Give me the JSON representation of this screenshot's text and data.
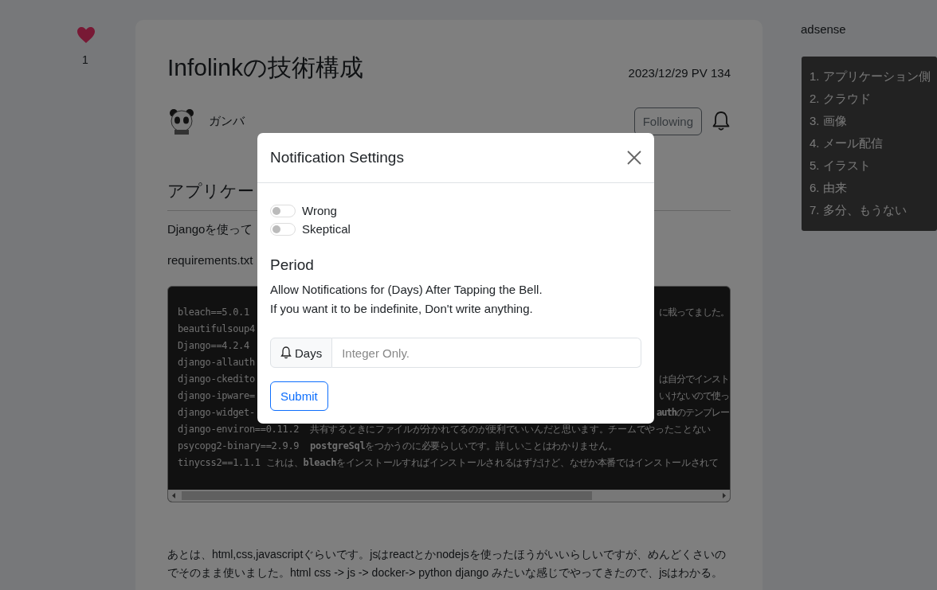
{
  "like": {
    "count": "1"
  },
  "article": {
    "title": "Infolinkの技術構成",
    "meta": "2023/12/29 PV 134",
    "author": "ガンバ",
    "follow_button": "Following",
    "section_heading": "アプリケー",
    "paragraph_1": "Djangoを使って",
    "paragraph_2": "requirements.txt",
    "code_lines": [
      {
        "left": "bleach==5.0.1",
        "right": "に載ってました。"
      },
      {
        "left": "beautifulsoup4"
      },
      {
        "left": "Django==4.2.4"
      },
      {
        "left": "django-allauth"
      },
      {
        "left": "django-ckedito",
        "right": "は自分でインスト"
      },
      {
        "left": "django-ipware=",
        "right": "いけないので使っ"
      },
      {
        "left": "django-widget-",
        "right": "**auth**のテンプレー"
      },
      {
        "left": "django-environ==0.11.2  共有するときにファイルが分かれてるのが便利でいいんだと思います。チームでやったことない"
      },
      {
        "left": "psycopg2-binary==2.9.9  **postgreSql**をつかうのに必要らしいです。詳しいことはわかりません。"
      },
      {
        "left": "tinycss2==1.1.1 これは、**bleach**をインストールすればインストールされるはずだけど、なぜか本番ではインストールされて"
      }
    ],
    "closing": "あとは、html,css,javascriptぐらいです。jsはreactとかnodejsを使ったほうがいいらしいですが、めんどくさいのでそのまま使いました。html css -> js -> docker-> python django みたいな感じでやってきたので、jsはわかる。"
  },
  "sidebar": {
    "ad_label": "adsense",
    "toc": [
      "1. アプリケーション側",
      "2. クラウド",
      "3. 画像",
      "4. メール配信",
      "5. イラスト",
      "6. 由来",
      "7. 多分、もうない"
    ]
  },
  "modal": {
    "title": "Notification Settings",
    "toggles": [
      {
        "label": "Wrong",
        "on": false
      },
      {
        "label": "Skeptical",
        "on": false
      }
    ],
    "period_heading": "Period",
    "description": [
      "Allow Notifications for (Days) After Tapping the Bell.",
      "If you want it to be indefinite, Don't write anything."
    ],
    "input_label": "Days",
    "placeholder": "Integer Only.",
    "submit": "Submit"
  }
}
